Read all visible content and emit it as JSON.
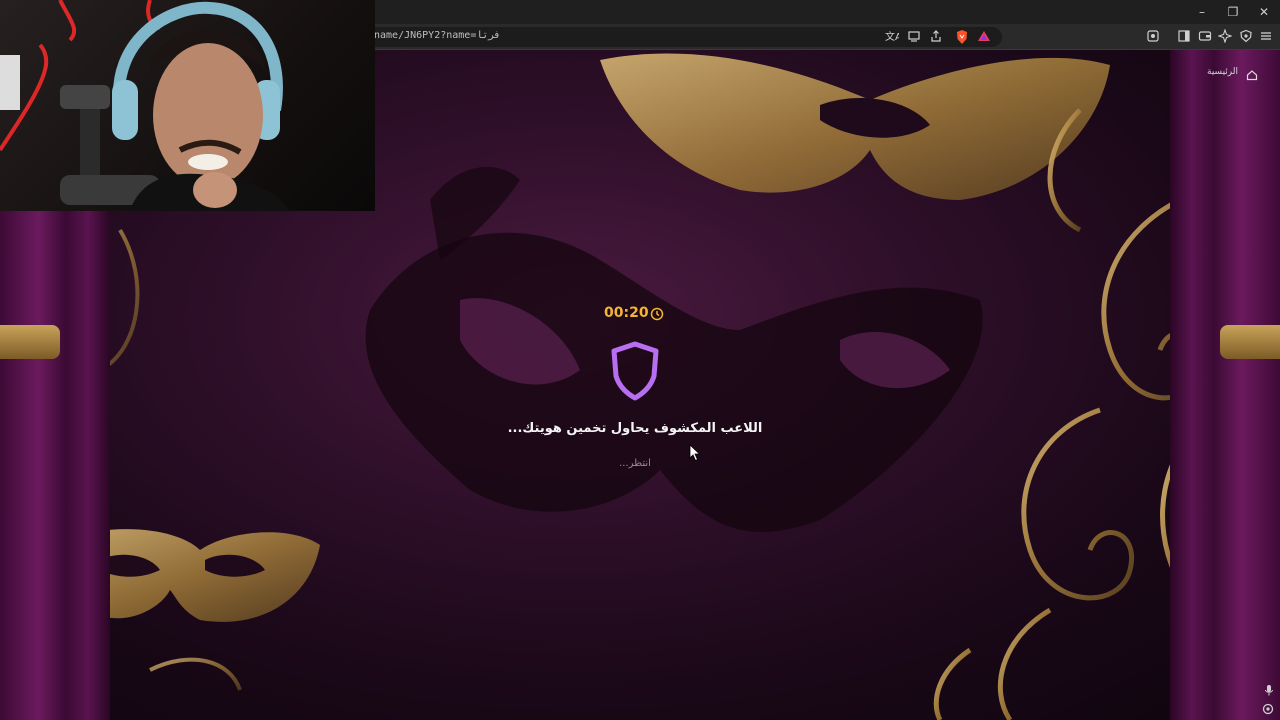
{
  "browser": {
    "url": "name/JN6PY2?name=فرتا",
    "window_controls": {
      "minimize": "–",
      "restore": "❐",
      "close": "✕"
    }
  },
  "page": {
    "home_label": "الرئيسية",
    "timer": "00:20",
    "status_title": "اللاعب المكشوف يحاول تخمين هويتك...",
    "status_sub": "انتظر..."
  },
  "colors": {
    "timer": "#f5b530",
    "shield": "#b86ef0",
    "background": "#2e0f29"
  },
  "icons": [
    "translate-icon",
    "cast-icon",
    "share-icon",
    "brave-shield-icon",
    "brave-rewards-icon",
    "bookmark-icon",
    "sidebar-icon",
    "wallet-icon",
    "leo-icon",
    "vpn-icon",
    "menu-icon",
    "home-icon",
    "clock-icon",
    "shield-icon",
    "mic-icon",
    "settings-icon",
    "cursor-icon"
  ]
}
